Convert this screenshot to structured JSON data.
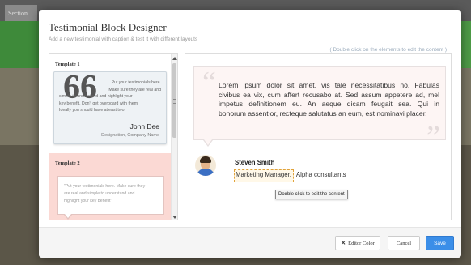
{
  "background": {
    "tab_label": "Section"
  },
  "modal": {
    "title": "Testimonial Block Designer",
    "subtitle": "Add a new testimonial with caption & test it with different layouts",
    "hint": "( Double click on the elements to edit the content )"
  },
  "templates": [
    {
      "label": "Template 1",
      "quote_mark": "66",
      "lines": [
        "Put your testimonials here.",
        "Make sure they are real and",
        "simple to understand and highlight your",
        "key benefit. Don't get overboard with them",
        "Ideally you should have atleast two."
      ],
      "name": "John Dee",
      "designation": "Designation, Company Name"
    },
    {
      "label": "Template 2",
      "lines": [
        "\"Put your testimonials here. Make sure they",
        "are real and simple to understand and",
        "highlight your key benefit\""
      ]
    }
  ],
  "preview": {
    "quote_lines": [
      "Lorem ipsum dolor sit amet, vis tale necessitatibus no. Fabulas",
      "civibus ea vix, cum affert recusabo at. Sed assum appetere ad, mel",
      "impetus definitionem eu. An aeque dicam feugait sea. Qui in",
      "bonorum assentior, recteque salutatus an eum, est nominavi placer."
    ],
    "name": "Steven Smith",
    "designation": "Marketing Manager,",
    "company": "Alpha consultants",
    "tooltip": "Double click to edit the content"
  },
  "footer": {
    "editor_color": "Editor Color",
    "editor_icon": "shuffle-icon",
    "cancel": "Cancel",
    "save": "Save"
  },
  "colors": {
    "save": "#3b8ee8",
    "template2_bg": "#fbd9d4",
    "selection_border": "#e0a23a"
  }
}
